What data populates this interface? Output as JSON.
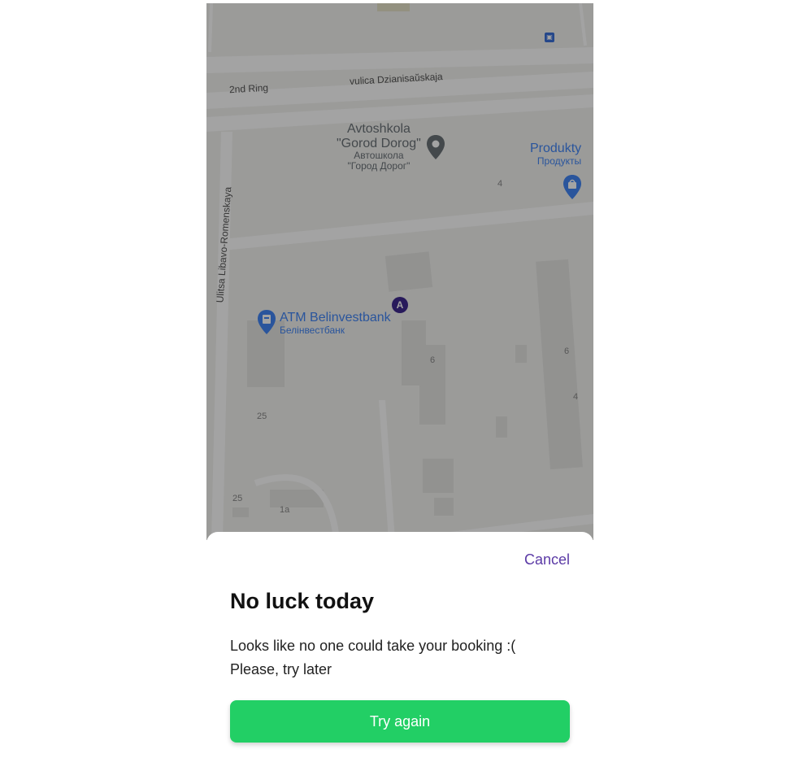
{
  "map": {
    "roads": {
      "ring": "2nd Ring",
      "street_main": "vulica Dzianisaŭskaja",
      "street_side": "Ulitsa Libavo-Romenskaya"
    },
    "pois": {
      "school_en_line1": "Avtoshkola",
      "school_en_line2": "\"Gorod Dorog\"",
      "school_ru_line1": "Автошкола",
      "school_ru_line2": "\"Город Дорог\"",
      "shop_en": "Produkty",
      "shop_ru": "Продукты",
      "atm_en": "ATM Belinvestbank",
      "atm_ru": "Белінвестбанк"
    },
    "marker_label": "A",
    "house_numbers": [
      "4",
      "6",
      "6",
      "4",
      "25",
      "25",
      "1a"
    ],
    "colors": {
      "poi_blue": "#4285f4",
      "poi_gray": "#6b7278",
      "marker_purple": "#3f2a8f",
      "transit_blue": "#3b6fd8"
    }
  },
  "dialog": {
    "cancel_label": "Cancel",
    "title": "No luck today",
    "message_line1": "Looks like no one could take your booking :(",
    "message_line2": "Please, try later",
    "action_label": "Try again"
  },
  "colors": {
    "accent": "#5b3aa6",
    "primary_button": "#22cf65"
  }
}
